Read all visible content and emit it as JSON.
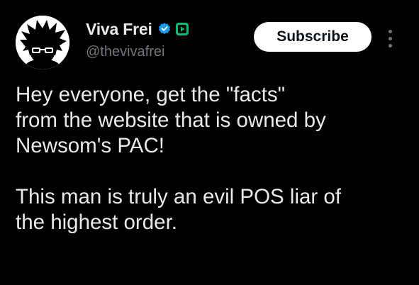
{
  "author": {
    "display_name": "Viva Frei",
    "handle": "@thevivafrei",
    "avatar_icon": "avatar-icon",
    "verified_icon": "verified-badge-icon",
    "affiliate_icon": "affiliate-play-icon"
  },
  "actions": {
    "subscribe_label": "Subscribe",
    "more_icon": "more-vertical-icon"
  },
  "tweet": {
    "paragraph_1": "Hey everyone, get the \"facts\"\nfrom the website that is owned by\nNewsom's PAC!",
    "paragraph_2": "This man is truly an evil POS liar of\nthe highest order."
  },
  "colors": {
    "background": "#000000",
    "text": "#e7e9ea",
    "secondary_text": "#71767b",
    "verified_blue": "#1d9bf0",
    "affiliate_green": "#00ba7c",
    "button_bg": "#ffffff",
    "button_text": "#0f1419"
  }
}
